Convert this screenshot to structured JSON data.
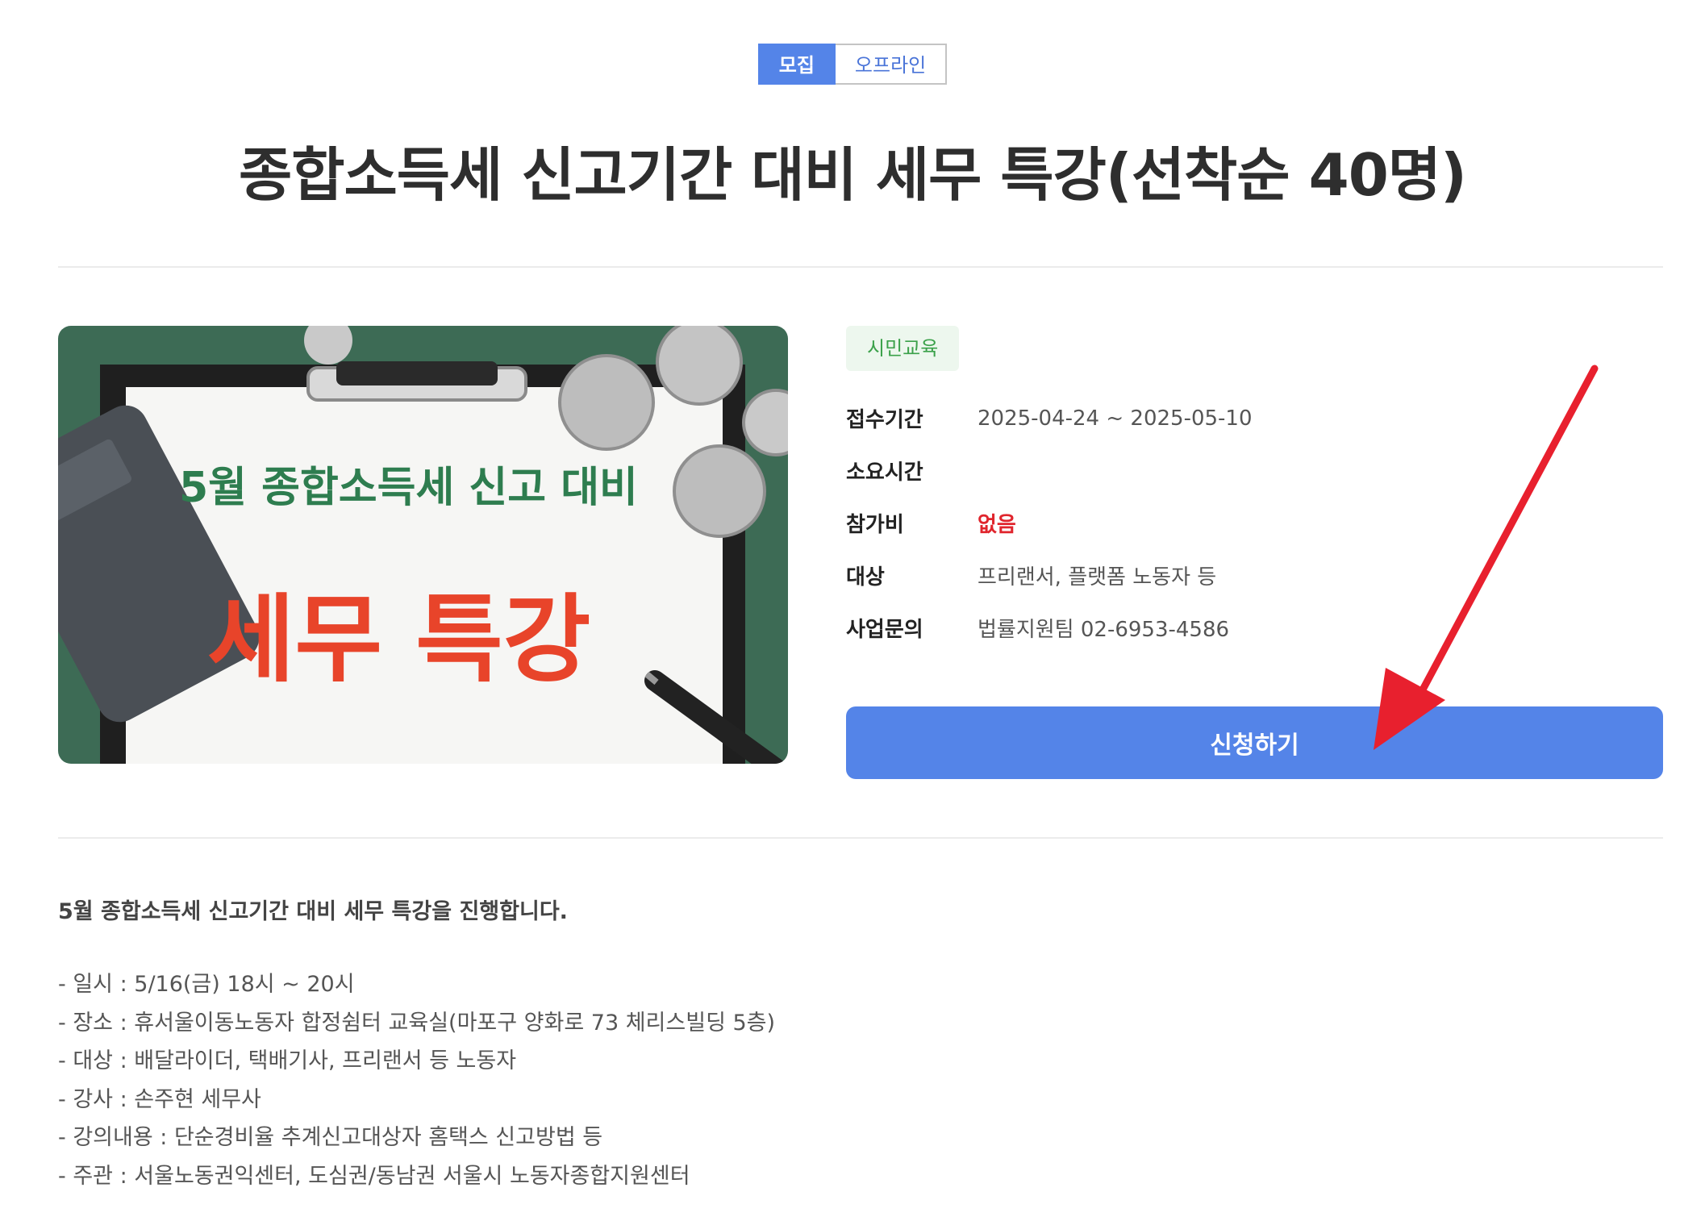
{
  "tags": {
    "status": "모집",
    "mode": "오프라인"
  },
  "title": "종합소득세 신고기간 대비 세무 특강(선착순 40명)",
  "thumbnail": {
    "headline": "5월 종합소득세 신고 대비",
    "main_text": "세무 특강",
    "colors": {
      "background": "#3d6b55",
      "headline": "#2e7d4f",
      "main_text": "#e8442a"
    }
  },
  "category": "시민교육",
  "info": [
    {
      "label": "접수기간",
      "value": "2025-04-24 ~ 2025-05-10"
    },
    {
      "label": "소요시간",
      "value": ""
    },
    {
      "label": "참가비",
      "value": "없음"
    },
    {
      "label": "대상",
      "value": "프리랜서, 플랫폼 노동자 등"
    },
    {
      "label": "사업문의",
      "value": "법률지원팀 02-6953-4586"
    }
  ],
  "apply_button": "신청하기",
  "description": {
    "headline": "5월 종합소득세 신고기간 대비 세무 특강을 진행합니다.",
    "lines": [
      "- 일시 : 5/16(금) 18시 ~ 20시",
      "- 장소 : 휴서울이동노동자 합정쉼터 교육실(마포구  양화로 73 체리스빌딩 5층)",
      "- 대상 : 배달라이더, 택배기사, 프리랜서 등 노동자",
      "- 강사 : 손주현 세무사",
      "- 강의내용 : 단순경비율 추계신고대상자 홈택스 신고방법 등",
      "- 주관 : 서울노동권익센터, 도심권/동남권 서울시 노동자종합지원센터"
    ]
  },
  "colors": {
    "accent": "#5484e8",
    "annotation_arrow": "#e8202e",
    "fee_highlight": "#e0252d",
    "category_green": "#3ba14a"
  }
}
